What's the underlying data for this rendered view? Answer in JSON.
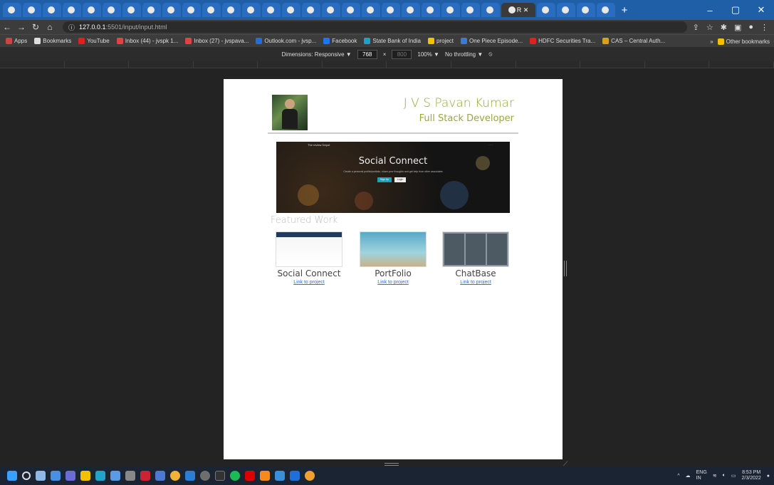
{
  "browser": {
    "active_tab": "R",
    "url_host": "127.0.0.1",
    "url_path": ":5501/input/input.html",
    "window_controls": [
      "–",
      "▢",
      "✕"
    ],
    "bookmarks": [
      {
        "label": "Apps",
        "color": "#c44"
      },
      {
        "label": "Bookmarks",
        "color": "#ddd"
      },
      {
        "label": "YouTube",
        "color": "#e02020"
      },
      {
        "label": "Inbox (44) - jvspk 1...",
        "color": "#d44"
      },
      {
        "label": "Inbox (27) - jvspava...",
        "color": "#d44"
      },
      {
        "label": "Outlook.com - jvsp...",
        "color": "#1e6fd9"
      },
      {
        "label": "Facebook",
        "color": "#1877f2"
      },
      {
        "label": "State Bank of India",
        "color": "#1da1c7"
      },
      {
        "label": "project",
        "color": "#f2c200"
      },
      {
        "label": "One Piece Episode...",
        "color": "#3a7ad9"
      },
      {
        "label": "HDFC Securities Tra...",
        "color": "#d22"
      },
      {
        "label": "CAS – Central Auth...",
        "color": "#d9a21b"
      }
    ],
    "bookmarks_right": "Other bookmarks"
  },
  "devtools": {
    "dimensions_label": "Dimensions: Responsive ▼",
    "width": "768",
    "height": "800",
    "zoom": "100% ▼",
    "throttle": "No throttling ▼"
  },
  "page": {
    "name": "J V S Pavan Kumar",
    "role": "Full Stack Developer",
    "hero_brand": "The review Depot",
    "hero_title": "Social Connect",
    "hero_subtitle": "Create a personal profile/portfolio, share your thoughts and get help from other associates",
    "hero_btn_signup": "Sign Up",
    "hero_btn_login": "Login",
    "featured_heading": "Featured Work",
    "projects": [
      {
        "title": "Social Connect",
        "link": "Link to project"
      },
      {
        "title": "PortFolio",
        "link": "Link to project"
      },
      {
        "title": "ChatBase",
        "link": "Link to project"
      }
    ]
  },
  "taskbar": {
    "lang": "ENG\nIN",
    "time": "8:53 PM",
    "date": "2/3/2022"
  }
}
